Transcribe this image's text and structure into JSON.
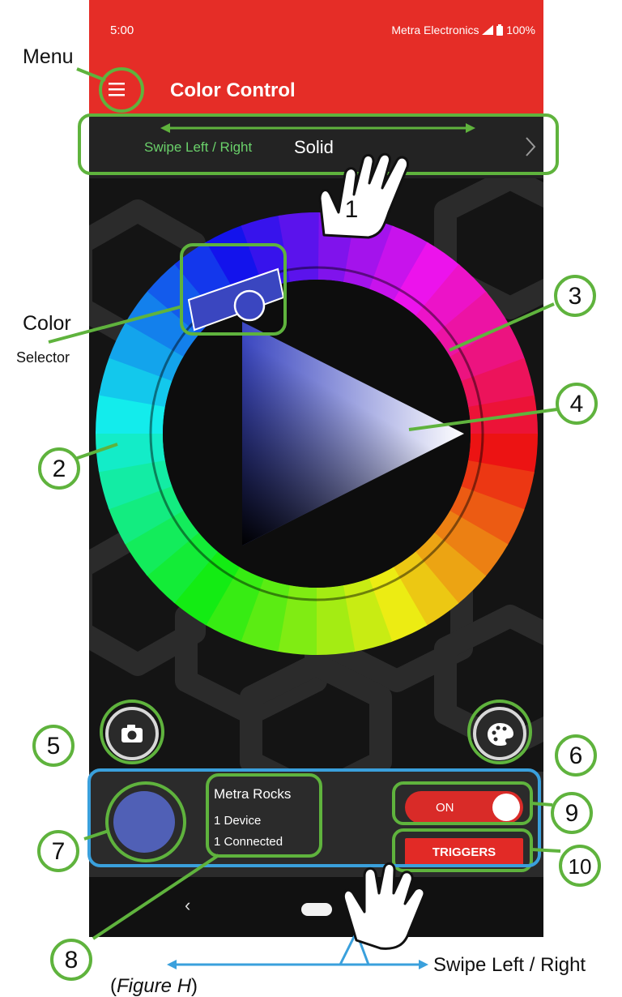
{
  "status_bar": {
    "time": "5:00",
    "carrier": "Metra Electronics",
    "battery": "100%"
  },
  "app_bar": {
    "title": "Color Control",
    "menu_icon": "hamburger-menu-icon"
  },
  "mode_selector": {
    "hint": "Swipe Left / Right",
    "value": "Solid",
    "next_icon": "chevron-right-icon"
  },
  "color_picker": {
    "selected_color": "#5060b6"
  },
  "actions": {
    "camera_icon": "camera-icon",
    "palette_icon": "palette-icon"
  },
  "device": {
    "name": "Metra Rocks",
    "devices": "1 Device",
    "connected": "1 Connected",
    "swatch_color": "#5060b6"
  },
  "power_toggle": {
    "label": "ON",
    "on": true
  },
  "triggers_button": {
    "label": "TRIGGERS"
  },
  "nav_bar": {
    "back_icon": "back-icon",
    "home_icon": "home-pill-icon"
  },
  "annotations": {
    "menu": "Menu",
    "color": "Color",
    "selector": "Selector",
    "swipe_bottom": "Swipe Left / Right",
    "caption_open": "(",
    "caption_figure": "Figure H",
    "caption_close": ")",
    "callouts": [
      "1",
      "2",
      "3",
      "4",
      "5",
      "6",
      "7",
      "8",
      "9",
      "10"
    ]
  },
  "colors": {
    "brand_red": "#e52d27",
    "callout_green": "#5fb33d",
    "panel_outline_blue": "#3aa0dc",
    "hint_green": "#6ad06a"
  }
}
